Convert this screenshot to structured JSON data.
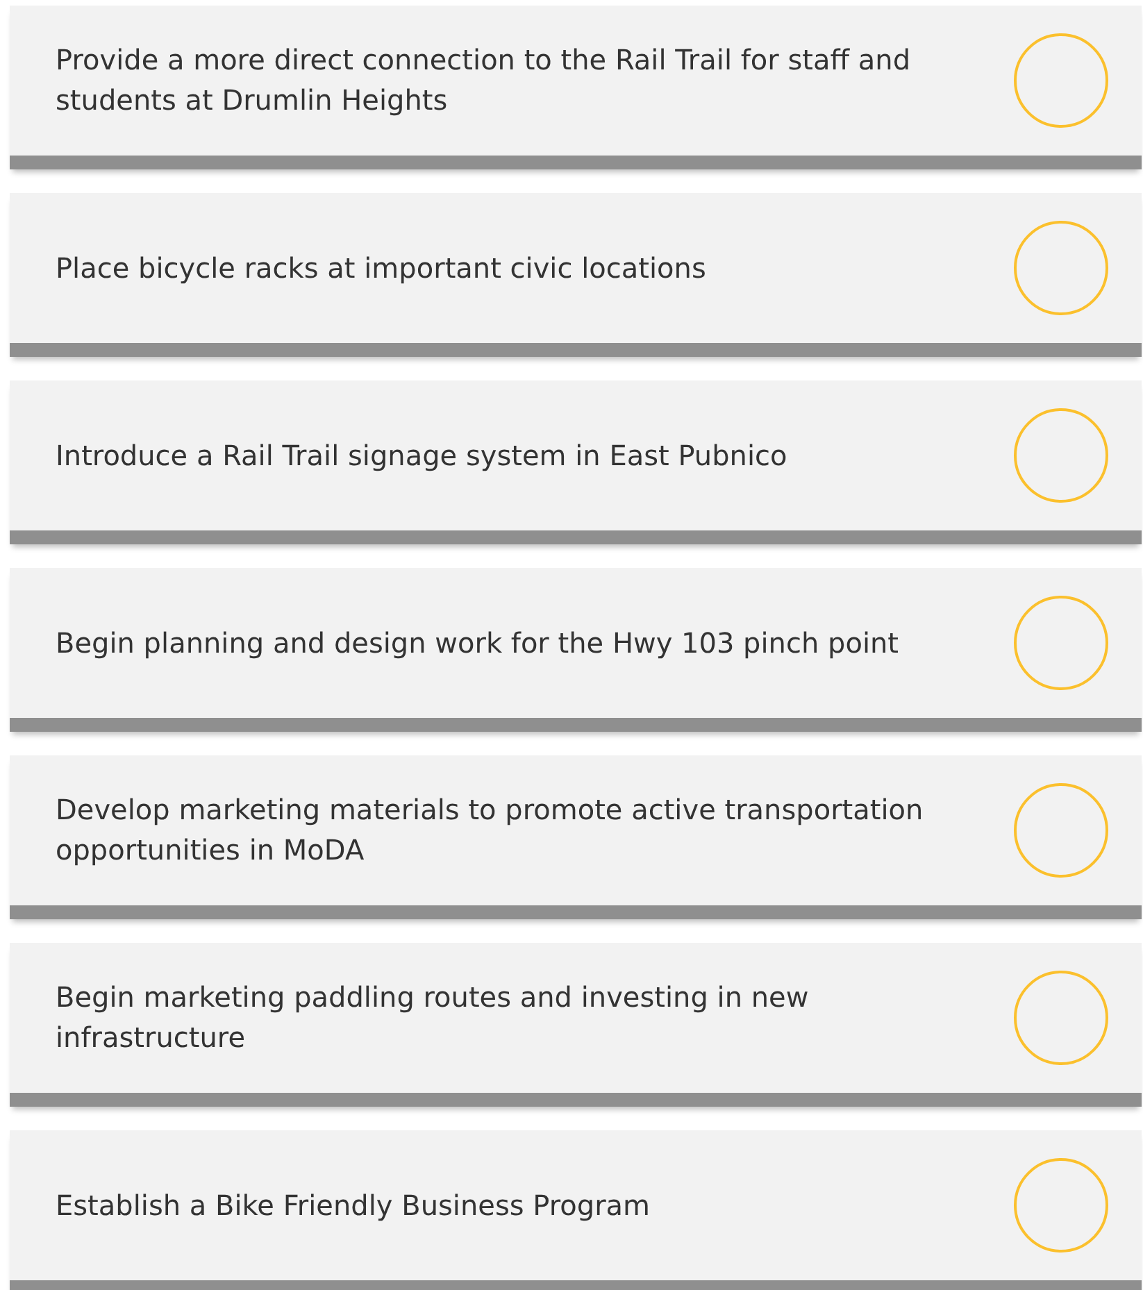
{
  "items": [
    {
      "text": "Provide a more direct connection to the Rail Trail for staff and students at Drumlin Heights",
      "checked": false
    },
    {
      "text": "Place bicycle racks at important civic locations",
      "checked": false
    },
    {
      "text": "Introduce a Rail Trail signage system in East Pubnico",
      "checked": false
    },
    {
      "text": "Begin planning and design work for the Hwy 103 pinch point",
      "checked": false
    },
    {
      "text": "Develop marketing materials to promote active transportation opportunities in MoDA",
      "checked": false
    },
    {
      "text": "Begin marketing paddling routes and investing in new infrastructure",
      "checked": false
    },
    {
      "text": "Establish a Bike Friendly Business Program",
      "checked": false
    }
  ]
}
